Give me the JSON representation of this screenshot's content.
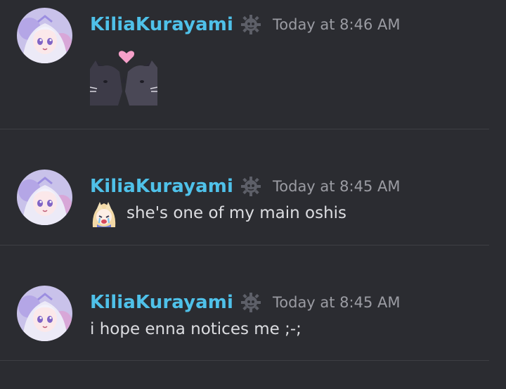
{
  "messages": [
    {
      "author": "KiliaKurayami",
      "timestamp": "Today at 8:46 AM",
      "attachment": "cat-kiss-sticker"
    },
    {
      "author": "KiliaKurayami",
      "timestamp": "Today at 8:45 AM",
      "text": "she's one of my main oshis",
      "emoji": "enna-crying-emoji"
    },
    {
      "author": "KiliaKurayami",
      "timestamp": "Today at 8:45 AM",
      "text": "i hope enna notices me ;-;"
    }
  ],
  "icons": {
    "badge": "gear-badge-icon"
  },
  "colors": {
    "background": "#2b2c31",
    "username": "#4fc1e9",
    "timestamp": "#9b9ca3",
    "text": "#dcdde1",
    "divider": "#3d3e44"
  }
}
